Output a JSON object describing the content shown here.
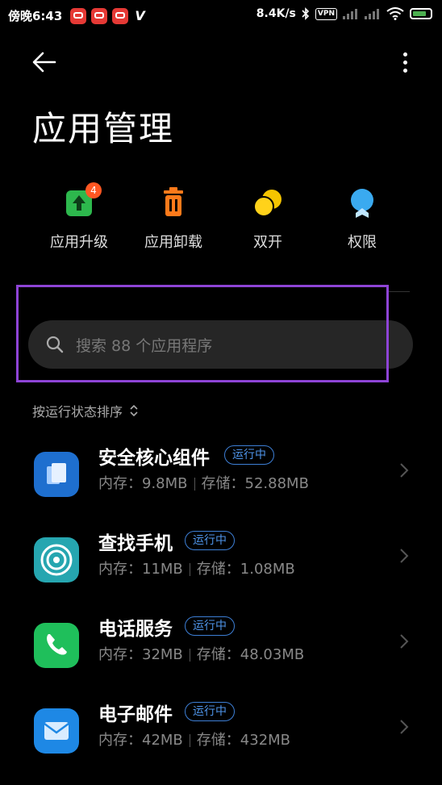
{
  "status_bar": {
    "time": "傍晚6:43",
    "speed": "8.4K/s",
    "vpn": "VPN"
  },
  "header": {
    "title": "应用管理"
  },
  "quick_actions": [
    {
      "label": "应用升级",
      "badge": "4",
      "icon": "upgrade-icon"
    },
    {
      "label": "应用卸载",
      "icon": "trash-icon"
    },
    {
      "label": "双开",
      "icon": "dual-app-icon"
    },
    {
      "label": "权限",
      "icon": "permission-icon"
    }
  ],
  "search": {
    "placeholder": "搜索 88 个应用程序"
  },
  "sort": {
    "label": "按运行状态排序"
  },
  "apps": [
    {
      "name": "安全核心组件",
      "status": "运行中",
      "memory": "内存：9.8MB",
      "storage": "存储：52.88MB",
      "color": "#1e6fcf"
    },
    {
      "name": "查找手机",
      "status": "运行中",
      "memory": "内存：11MB",
      "storage": "存储：1.08MB",
      "color": "#26a6b0"
    },
    {
      "name": "电话服务",
      "status": "运行中",
      "memory": "内存：32MB",
      "storage": "存储：48.03MB",
      "color": "#1fbf5b"
    },
    {
      "name": "电子邮件",
      "status": "运行中",
      "memory": "内存：42MB",
      "storage": "存储：432MB",
      "color": "#1e88e5"
    }
  ]
}
